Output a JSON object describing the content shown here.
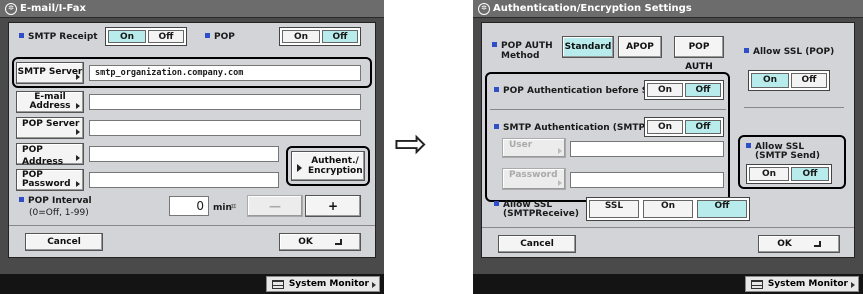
{
  "left": {
    "title": "E-mail/I-Fax",
    "smtp_receipt_label": "SMTP Receipt",
    "smtp_receipt_on": "On",
    "smtp_receipt_off": "Off",
    "pop_label": "POP",
    "pop_on": "On",
    "pop_off": "Off",
    "smtp_server_button": "SMTP Server",
    "smtp_server_value": "smtp_organization.company.com",
    "email_address_button": "E-mail Address",
    "pop_server_button": "POP Server",
    "pop_address_button": "POP Address",
    "pop_password_button": "POP Password",
    "authent_button": "Authent./ Encryption",
    "pop_interval_label": "POP Interval",
    "pop_interval_range": "(0=Off, 1-99)",
    "pop_interval_value": "0",
    "pop_interval_unit": "min",
    "minus_label": "—",
    "plus_label": "+",
    "cancel_button": "Cancel",
    "ok_button": "OK",
    "system_monitor": "System Monitor"
  },
  "arrow": "⇨",
  "right": {
    "title": "Authentication/Encryption Settings",
    "pop_auth_method_label": "POP AUTH Method",
    "method_standard": "Standard",
    "method_apop": "APOP",
    "method_pop_auth": "POP AUTH",
    "allow_ssl_pop_label": "Allow SSL (POP)",
    "allow_ssl_pop_on": "On",
    "allow_ssl_pop_off": "Off",
    "pop_before_sending_label": "POP Authentication before Sending",
    "pop_before_sending_on": "On",
    "pop_before_sending_off": "Off",
    "smtp_auth_label": "SMTP Authentication (SMTP AUTH)",
    "smtp_auth_on": "On",
    "smtp_auth_off": "Off",
    "allow_ssl_smtp_send_label": "Allow SSL (SMTP Send)",
    "allow_ssl_smtp_send_on": "On",
    "allow_ssl_smtp_send_off": "Off",
    "user_button": "User",
    "password_button": "Password",
    "allow_ssl_smtp_receive_label": "Allow SSL (SMTPReceive)",
    "receive_ssl": "SSL",
    "receive_on": "On",
    "receive_off": "Off",
    "cancel_button": "Cancel",
    "ok_button": "OK",
    "system_monitor": "System Monitor"
  }
}
